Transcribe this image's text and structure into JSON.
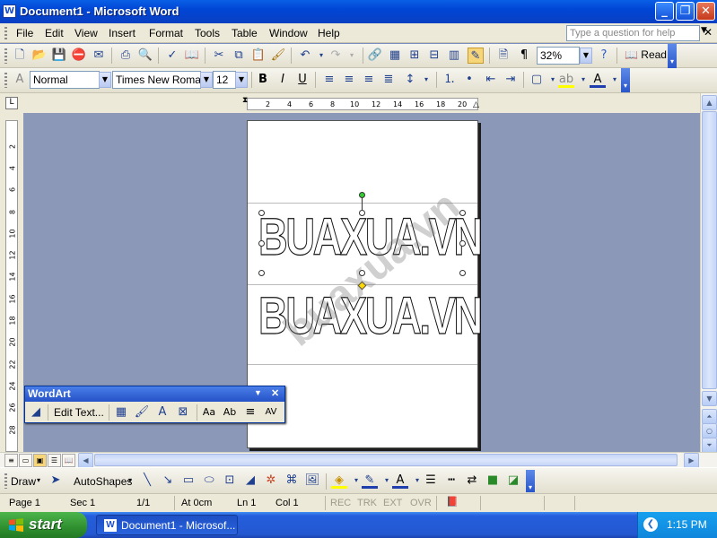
{
  "window": {
    "title": "Document1 - Microsoft Word",
    "app_icon": "W"
  },
  "menubar": {
    "items": [
      "File",
      "Edit",
      "View",
      "Insert",
      "Format",
      "Tools",
      "Table",
      "Window",
      "Help"
    ],
    "help_placeholder": "Type a question for help"
  },
  "standard_toolbar": {
    "zoom": "32%",
    "read_label": "Read"
  },
  "formatting_toolbar": {
    "style": "Normal",
    "font": "Times New Roman",
    "size": "12"
  },
  "ruler": {
    "top_ticks": [
      "2",
      "4",
      "6",
      "8",
      "10",
      "12",
      "14",
      "16",
      "18",
      "20"
    ],
    "left_ticks": [
      "2",
      "4",
      "6",
      "8",
      "10",
      "12",
      "14",
      "16",
      "18",
      "20",
      "22",
      "24",
      "26",
      "28"
    ]
  },
  "document": {
    "wordart_text_1": "BUAXUA.VN",
    "wordart_text_2": "BUAXUA.VN",
    "watermark": "buaxua.vn"
  },
  "wordart_toolbar": {
    "title": "WordArt",
    "edit_text_label": "Edit Text..."
  },
  "drawing_toolbar": {
    "draw_label": "Draw",
    "autoshapes_label": "AutoShapes"
  },
  "statusbar": {
    "page": "Page 1",
    "section": "Sec 1",
    "page_of": "1/1",
    "at": "At 0cm",
    "line": "Ln 1",
    "col": "Col 1",
    "rec": "REC",
    "trk": "TRK",
    "ext": "EXT",
    "ovr": "OVR"
  },
  "taskbar": {
    "start_label": "start",
    "task_item": "Document1 - Microsof...",
    "clock": "1:15 PM"
  },
  "colors": {
    "titlebar": "#0046d5",
    "chrome": "#ece9d8",
    "workspace": "#8c98b8",
    "taskbar": "#245edc",
    "start": "#2f8f2f"
  }
}
